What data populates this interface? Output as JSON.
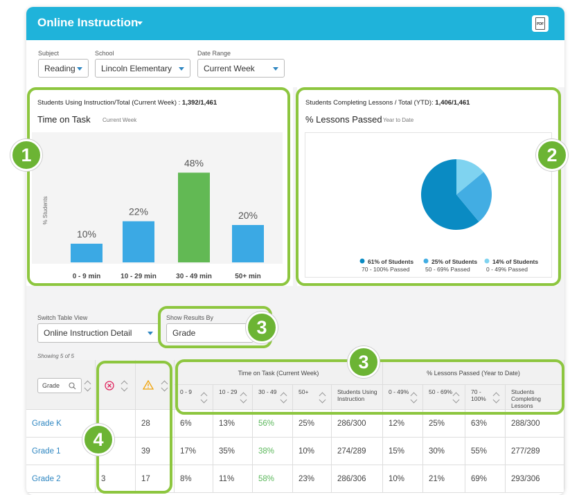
{
  "header": {
    "title": "Online Instruction",
    "pdf_label": "PDF"
  },
  "filters": {
    "subject": {
      "label": "Subject",
      "value": "Reading"
    },
    "school": {
      "label": "School",
      "value": "Lincoln Elementary"
    },
    "date_range": {
      "label": "Date Range",
      "value": "Current Week"
    }
  },
  "panel1": {
    "summary_label": "Students Using Instruction/Total (Current Week) :",
    "summary_value": "1,392/1,461",
    "heading": "Time on Task",
    "subheading": "Current Week",
    "ylabel": "% Students"
  },
  "panel2": {
    "summary_label": "Students Completing Lessons / Total (YTD):",
    "summary_value": "1,406/1,461",
    "heading": "% Lessons Passed",
    "subheading": "Year to Date",
    "legend": [
      {
        "title": "61% of Students",
        "sub": "70 - 100% Passed",
        "color": "#0a8bc3"
      },
      {
        "title": "25% of Students",
        "sub": "50 - 69% Passed",
        "color": "#42ade3"
      },
      {
        "title": "14% of Students",
        "sub": "0 - 49% Passed",
        "color": "#7fd3f0"
      }
    ]
  },
  "chart_data": [
    {
      "type": "bar",
      "title": "Time on Task",
      "subtitle": "Current Week",
      "ylabel": "% Students",
      "categories": [
        "0 - 9 min",
        "10 - 29 min",
        "30 - 49 min",
        "50+ min"
      ],
      "values": [
        10,
        22,
        48,
        20
      ],
      "value_labels": [
        "10%",
        "22%",
        "48%",
        "20%"
      ],
      "colors": [
        "#3ba9e4",
        "#3ba9e4",
        "#62b954",
        "#3ba9e4"
      ],
      "ylim": [
        0,
        60
      ],
      "grid": false
    },
    {
      "type": "pie",
      "title": "% Lessons Passed",
      "subtitle": "Year to Date",
      "categories": [
        "70 - 100% Passed",
        "50 - 69% Passed",
        "0 - 49% Passed"
      ],
      "values": [
        61,
        25,
        14
      ],
      "colors": [
        "#0a8bc3",
        "#42ade3",
        "#7fd3f0"
      ]
    }
  ],
  "controls": {
    "switch_label": "Switch Table View",
    "switch_value": "Online Instruction Detail",
    "show_label": "Show Results By",
    "show_value": "Grade",
    "showing": "Showing 5 of 5"
  },
  "badges": [
    "1",
    "2",
    "3",
    "3",
    "4"
  ],
  "table": {
    "grade_header": "Grade",
    "group1_title": "Time on Task (Current Week)",
    "group2_title": "% Lessons Passed (Year to Date)",
    "col_headers": [
      "0 - 9",
      "10 - 29",
      "30 - 49",
      "50+",
      "Students Using Instruction",
      "0 - 49%",
      "50 - 69%",
      "70 - 100%",
      "Students Completing Lessons"
    ],
    "rows": [
      {
        "grade": "Grade K",
        "c1": "",
        "c2": "28",
        "v": [
          "6%",
          "13%",
          "56%",
          "25%",
          "286/300",
          "12%",
          "25%",
          "63%",
          "288/300"
        ]
      },
      {
        "grade": "Grade 1",
        "c1": "",
        "c2": "39",
        "v": [
          "17%",
          "35%",
          "38%",
          "10%",
          "274/289",
          "15%",
          "30%",
          "55%",
          "277/289"
        ]
      },
      {
        "grade": "Grade 2",
        "c1": "3",
        "c2": "17",
        "v": [
          "8%",
          "11%",
          "58%",
          "23%",
          "286/306",
          "10%",
          "21%",
          "69%",
          "293/306"
        ]
      }
    ]
  }
}
